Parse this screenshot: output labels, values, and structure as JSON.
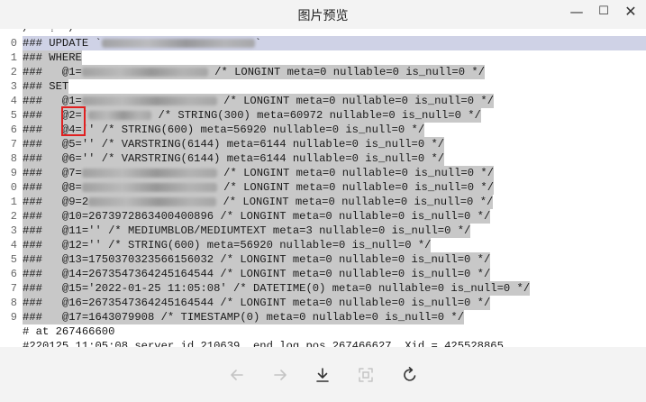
{
  "window": {
    "title": "图片预览",
    "controls": {
      "minimize": "—",
      "maximize": "☐",
      "close": "✕"
    }
  },
  "gutter": [
    "0",
    "1",
    "2",
    "3",
    "4",
    "5",
    "6",
    "7",
    "8",
    "9",
    "0",
    "1",
    "2",
    "3",
    "4",
    "5",
    "6",
    "7",
    "8",
    "9"
  ],
  "code_lines": [
    {
      "text": "/ * ! */",
      "selected": false
    },
    {
      "prefix": "### UPDATE `",
      "blur": 170,
      "suffix": "`",
      "selected": true,
      "current": true
    },
    {
      "text": "### WHERE",
      "selected": true
    },
    {
      "prefix": "###   @1=",
      "blur": 140,
      "suffix": " /* LONGINT meta=0 nullable=0 is_null=0 */",
      "selected": true
    },
    {
      "text": "### SET",
      "selected": true
    },
    {
      "prefix": "###   @1=",
      "blur": 150,
      "suffix": " /* LONGINT meta=0 nullable=0 is_null=0 */",
      "selected": true
    },
    {
      "prefix": "###   @2='",
      "blur": 70,
      "suffix": " /* STRING(300) meta=60972 nullable=0 is_null=0 */",
      "selected": true
    },
    {
      "text": "###   @4='' /* STRING(600) meta=56920 nullable=0 is_null=0 */",
      "selected": true
    },
    {
      "text": "###   @5='' /* VARSTRING(6144) meta=6144 nullable=0 is_null=0 */",
      "selected": true
    },
    {
      "text": "###   @6='' /* VARSTRING(6144) meta=6144 nullable=0 is_null=0 */",
      "selected": true
    },
    {
      "prefix": "###   @7=",
      "blur": 150,
      "suffix": " /* LONGINT meta=0 nullable=0 is_null=0 */",
      "selected": true
    },
    {
      "prefix": "###   @8=",
      "blur": 150,
      "suffix": " /* LONGINT meta=0 nullable=0 is_null=0 */",
      "selected": true
    },
    {
      "prefix": "###   @9=2",
      "blur": 142,
      "suffix": " /* LONGINT meta=0 nullable=0 is_null=0 */",
      "selected": true
    },
    {
      "text": "###   @10=2673972863400400896 /* LONGINT meta=0 nullable=0 is_null=0 */",
      "selected": true
    },
    {
      "text": "###   @11='' /* MEDIUMBLOB/MEDIUMTEXT meta=3 nullable=0 is_null=0 */",
      "selected": true
    },
    {
      "text": "###   @12='' /* STRING(600) meta=56920 nullable=0 is_null=0 */",
      "selected": true
    },
    {
      "text": "###   @13=1750370323566156032 /* LONGINT meta=0 nullable=0 is_null=0 */",
      "selected": true
    },
    {
      "text": "###   @14=2673547364245164544 /* LONGINT meta=0 nullable=0 is_null=0 */",
      "selected": true
    },
    {
      "text": "###   @15='2022-01-25 11:05:08' /* DATETIME(0) meta=0 nullable=0 is_null=0 */",
      "selected": true
    },
    {
      "text": "###   @16=2673547364245164544 /* LONGINT meta=0 nullable=0 is_null=0 */",
      "selected": true
    },
    {
      "text": "###   @17=1643079908 /* TIMESTAMP(0) meta=0 nullable=0 is_null=0 */",
      "selected": true
    },
    {
      "text": "# at 267466600",
      "selected": false
    },
    {
      "text": "#220125 11:05:08 server id 210639  end_log_pos 267466627  Xid = 425528865",
      "selected": false
    }
  ],
  "toolbar": {
    "prev": "arrow-left-icon",
    "next": "arrow-right-icon",
    "download": "download-icon",
    "fit": "fit-screen-icon",
    "rotate": "rotate-icon"
  },
  "colors": {
    "selection": "#c8c8c8",
    "current_line": "#cfd2e6",
    "annotation": "#e02020"
  }
}
